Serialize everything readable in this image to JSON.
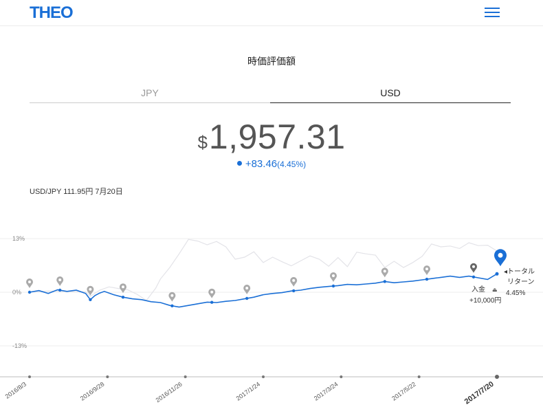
{
  "header": {
    "logo": "THEO",
    "menu_icon": "hamburger-icon"
  },
  "page_title": "時価評価額",
  "tabs": [
    {
      "label": "JPY",
      "active": false
    },
    {
      "label": "USD",
      "active": true
    }
  ],
  "valuation": {
    "currency_symbol": "$",
    "amount": "1,957.31"
  },
  "change": {
    "amount": "+83.46",
    "percent": "(4.45%)"
  },
  "fx_rate": "USD/JPY 111.95円 7月20日",
  "colors": {
    "accent": "#1a6fd6",
    "benchmark": "#e3e3e8",
    "pin": "#aaaaaa"
  },
  "chart_data": {
    "type": "line",
    "y_ticks": [
      "13%",
      "0%",
      "-13%"
    ],
    "ylim": [
      -13,
      13
    ],
    "x_ticks": [
      "2016/8/3",
      "2016/9/28",
      "2016/11/26",
      "2017/1/24",
      "2017/3/24",
      "2017/5/22",
      "2017/7/20"
    ],
    "series": [
      {
        "role": "portfolio",
        "x": [
          0,
          2,
          4,
          6,
          8,
          10,
          12,
          13,
          14,
          15,
          16,
          18,
          20,
          22,
          24,
          26,
          28,
          30,
          32,
          34,
          36,
          38,
          40,
          42,
          44,
          46,
          48,
          50,
          52,
          54,
          56,
          58,
          60,
          62,
          64,
          66,
          68,
          70,
          72,
          74,
          76,
          78,
          80,
          82,
          84,
          86,
          88,
          90,
          92,
          94,
          96,
          98,
          100
        ],
        "values": [
          0.0,
          0.4,
          -0.3,
          0.6,
          0.2,
          0.5,
          -0.3,
          -1.8,
          -0.8,
          -0.2,
          0.2,
          -0.6,
          -1.2,
          -1.6,
          -1.8,
          -2.3,
          -2.5,
          -3.2,
          -3.6,
          -3.2,
          -2.8,
          -2.4,
          -2.5,
          -2.2,
          -2.0,
          -1.6,
          -1.2,
          -0.6,
          -0.3,
          -0.1,
          0.3,
          0.5,
          0.9,
          1.2,
          1.4,
          1.6,
          1.9,
          1.8,
          2.0,
          2.2,
          2.6,
          2.3,
          2.5,
          2.7,
          3.0,
          3.3,
          3.6,
          3.9,
          3.6,
          3.9,
          3.5,
          3.1,
          4.45
        ]
      },
      {
        "role": "benchmark",
        "x": [
          0,
          4,
          8,
          12,
          13,
          15,
          17,
          19,
          21,
          23,
          25,
          27,
          28,
          30,
          32,
          34,
          36,
          38,
          40,
          42,
          44,
          46,
          48,
          50,
          52,
          54,
          56,
          58,
          60,
          62,
          64,
          66,
          68,
          70,
          72,
          74,
          76,
          78,
          80,
          82,
          84,
          86,
          88,
          90,
          92,
          94,
          96,
          98,
          100
        ],
        "values": [
          0.0,
          0.3,
          0.2,
          0.1,
          -1.0,
          0.5,
          1.3,
          0.9,
          0.6,
          -0.5,
          -2.0,
          1.0,
          3.2,
          6.0,
          9.3,
          12.8,
          12.4,
          11.5,
          12.3,
          11.0,
          8.0,
          8.5,
          9.8,
          7.2,
          8.5,
          7.4,
          6.4,
          7.6,
          8.8,
          8.0,
          6.3,
          8.4,
          6.2,
          9.7,
          9.3,
          9.0,
          6.0,
          7.5,
          6.0,
          7.2,
          8.7,
          11.7,
          11.0,
          11.2,
          10.6,
          12.0,
          11.3,
          11.4,
          10.0
        ]
      }
    ],
    "deposit_markers_x": [
      0,
      6.5,
      13,
      20,
      30.5,
      39,
      46.5,
      56.5,
      65,
      76,
      85,
      95
    ],
    "final_point": {
      "x": 100,
      "value": 4.45
    },
    "annotations": {
      "total_return_label": "◂トータル\nリターン",
      "total_return_value": "4.45%",
      "deposit_label": "入金",
      "deposit_amount": "+10,000円"
    }
  }
}
